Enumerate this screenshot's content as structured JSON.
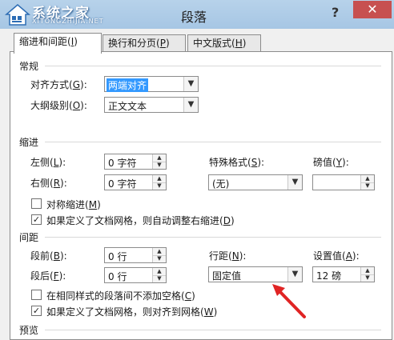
{
  "window": {
    "title": "段落",
    "help": "?",
    "close": "✕",
    "watermark": {
      "main": "系统之家",
      "sub": "XITONGZHIJIA.NET"
    }
  },
  "tabs": [
    {
      "label": "缩进和间距",
      "key": "I",
      "active": true
    },
    {
      "label": "换行和分页",
      "key": "P",
      "active": false
    },
    {
      "label": "中文版式",
      "key": "H",
      "active": false
    }
  ],
  "general": {
    "heading": "常规",
    "alignment_label": "对齐方式",
    "alignment_key": "G",
    "alignment_value": "两端对齐",
    "outline_label": "大纲级别",
    "outline_key": "O",
    "outline_value": "正文文本"
  },
  "indent": {
    "heading": "缩进",
    "left_label": "左侧",
    "left_key": "L",
    "left_value": "0 字符",
    "right_label": "右侧",
    "right_key": "R",
    "right_value": "0 字符",
    "special_label": "特殊格式",
    "special_key": "S",
    "special_value": "(无)",
    "by_label": "磅值",
    "by_key": "Y",
    "by_value": "",
    "mirror_label": "对称缩进",
    "mirror_key": "M",
    "mirror_checked": false,
    "auto_label": "如果定义了文档网格，则自动调整右缩进",
    "auto_key": "D",
    "auto_checked": true
  },
  "spacing": {
    "heading": "间距",
    "before_label": "段前",
    "before_key": "B",
    "before_value": "0 行",
    "after_label": "段后",
    "after_key": "F",
    "after_value": "0 行",
    "line_label": "行距",
    "line_key": "N",
    "line_value": "固定值",
    "at_label": "设置值",
    "at_key": "A",
    "at_value": "12 磅",
    "nospace_label": "在相同样式的段落间不添加空格",
    "nospace_key": "C",
    "nospace_checked": false,
    "grid_label": "如果定义了文档网格，则对齐到网格",
    "grid_key": "W",
    "grid_checked": true
  },
  "preview": {
    "heading": "预览"
  },
  "colors": {
    "annotation_arrow": "#e02424",
    "selection": "#3399ff",
    "close_bg": "#c75050"
  }
}
